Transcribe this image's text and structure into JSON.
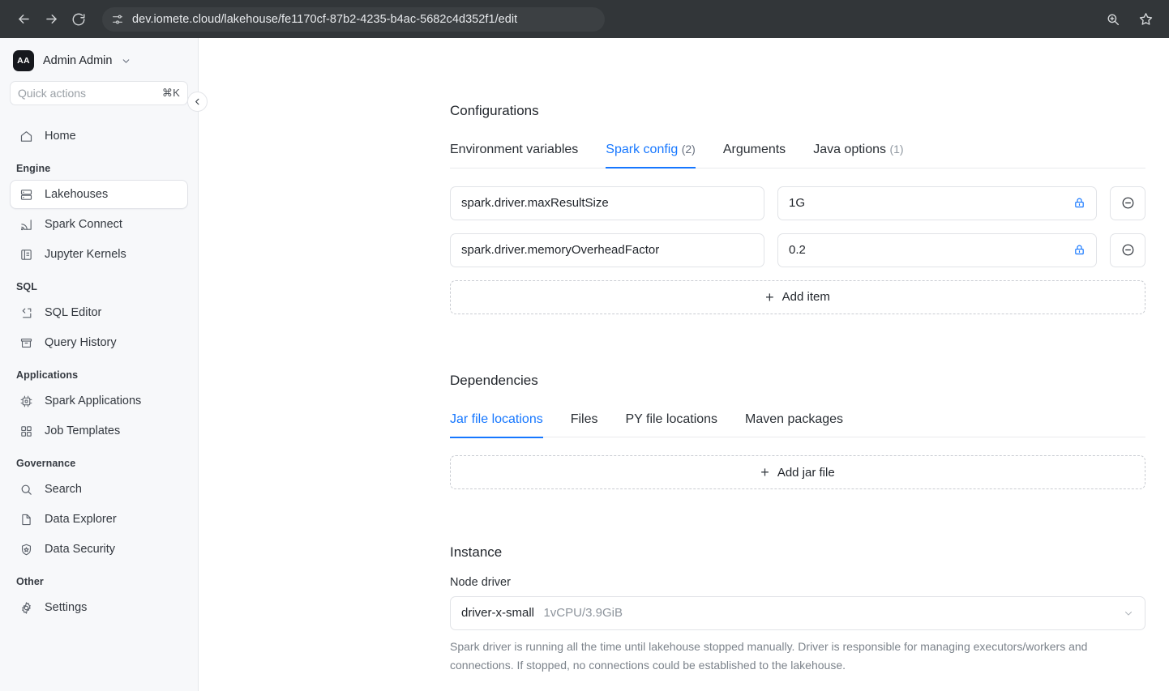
{
  "browser": {
    "url": "dev.iomete.cloud/lakehouse/fe1170cf-87b2-4235-b4ac-5682c4d352f1/edit",
    "back_icon": "back-arrow-icon",
    "forward_icon": "forward-arrow-icon",
    "reload_icon": "reload-icon",
    "site_info_icon": "site-settings-icon",
    "zoom_icon": "zoom-icon",
    "bookmark_icon": "star-icon"
  },
  "sidebar": {
    "user": {
      "initials": "AA",
      "name": "Admin Admin"
    },
    "quick_actions": {
      "placeholder": "Quick actions",
      "shortcut": "⌘K"
    },
    "collapse_label": "‹",
    "groups": [
      {
        "title": "",
        "items": [
          {
            "label": "Home",
            "icon": "home-icon",
            "active": false
          }
        ]
      },
      {
        "title": "Engine",
        "items": [
          {
            "label": "Lakehouses",
            "icon": "database-icon",
            "active": true
          },
          {
            "label": "Spark Connect",
            "icon": "spark-connect-icon",
            "active": false
          },
          {
            "label": "Jupyter Kernels",
            "icon": "notebook-icon",
            "active": false
          }
        ]
      },
      {
        "title": "SQL",
        "items": [
          {
            "label": "SQL Editor",
            "icon": "code-icon",
            "active": false
          },
          {
            "label": "Query History",
            "icon": "archive-icon",
            "active": false
          }
        ]
      },
      {
        "title": "Applications",
        "items": [
          {
            "label": "Spark Applications",
            "icon": "chip-icon",
            "active": false
          },
          {
            "label": "Job Templates",
            "icon": "grid-icon",
            "active": false
          }
        ]
      },
      {
        "title": "Governance",
        "items": [
          {
            "label": "Search",
            "icon": "search-icon",
            "active": false
          },
          {
            "label": "Data Explorer",
            "icon": "document-icon",
            "active": false
          },
          {
            "label": "Data Security",
            "icon": "shield-icon",
            "active": false
          }
        ]
      },
      {
        "title": "Other",
        "items": [
          {
            "label": "Settings",
            "icon": "gear-icon",
            "active": false
          }
        ]
      }
    ]
  },
  "configurations": {
    "title": "Configurations",
    "tabs": [
      {
        "label": "Environment variables",
        "count": "",
        "active": false
      },
      {
        "label": "Spark config",
        "count": "(2)",
        "active": true
      },
      {
        "label": "Arguments",
        "count": "",
        "active": false
      },
      {
        "label": "Java options",
        "count": "(1)",
        "active": false
      }
    ],
    "rows": [
      {
        "key": "spark.driver.maxResultSize",
        "value": "1G",
        "locked": true
      },
      {
        "key": "spark.driver.memoryOverheadFactor",
        "value": "0.2",
        "locked": true
      }
    ],
    "add_label": "Add item",
    "add_plus": "+",
    "lock_icon": "lock-icon",
    "remove_icon": "minus-circle-icon"
  },
  "dependencies": {
    "title": "Dependencies",
    "tabs": [
      {
        "label": "Jar file locations",
        "active": true
      },
      {
        "label": "Files",
        "active": false
      },
      {
        "label": "PY file locations",
        "active": false
      },
      {
        "label": "Maven packages",
        "active": false
      }
    ],
    "add_label": "Add jar file",
    "add_plus": "+"
  },
  "instance": {
    "title": "Instance",
    "node_driver_label": "Node driver",
    "node_driver_value": "driver-x-small",
    "node_driver_spec": "1vCPU/3.9GiB",
    "helper_text": "Spark driver is running all the time until lakehouse stopped manually. Driver is responsible for managing executors/workers and connections. If stopped, no connections could be established to the lakehouse.",
    "chevron_icon": "chevron-down-icon"
  },
  "colors": {
    "accent": "#1677ff",
    "chrome_bg": "#323639",
    "sidebar_bg": "#f7f8fa",
    "border": "#e1e3e7",
    "text": "#22262c",
    "muted": "#8d949c"
  }
}
